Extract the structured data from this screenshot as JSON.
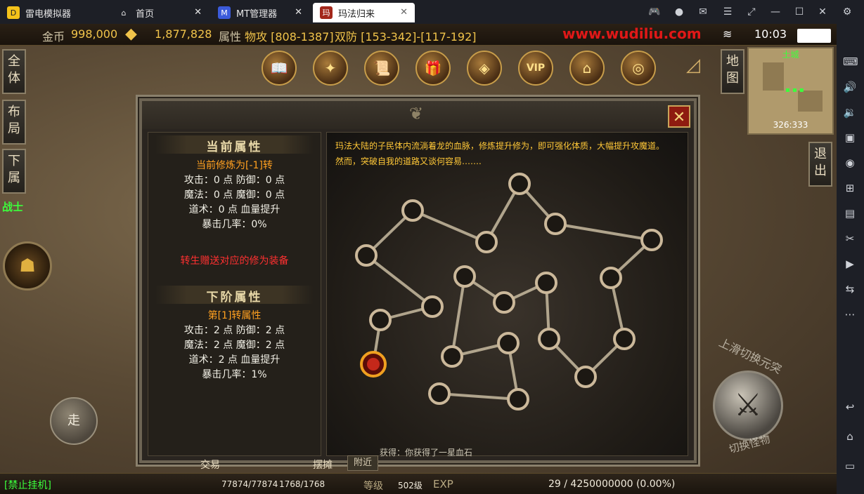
{
  "tabs": [
    {
      "label": "雷电模拟器",
      "icon": "leidian-logo-icon"
    },
    {
      "label": "首页",
      "icon": "home-icon"
    },
    {
      "label": "MT管理器",
      "icon": "mt-manager-icon"
    },
    {
      "label": "玛法归来",
      "icon": "game-icon"
    }
  ],
  "stats": {
    "gold_label": "金币",
    "gold_value": "998,000",
    "ingot_value": "1,877,828",
    "attr_label": "属性",
    "phys_atk": "物攻 [808-1387]",
    "dual_def": "双防 [153-342]-[117-192]",
    "website": "www.wudiliu.com",
    "time": "10:03"
  },
  "side_buttons": [
    "全体",
    "布局",
    "下属"
  ],
  "class_label": "战士",
  "map_buttons": [
    "地图",
    "退出"
  ],
  "minimap": {
    "area": "土城",
    "coords": "326:333"
  },
  "panel": {
    "current_title": "当前属性",
    "current_level": "当前修炼为[-1]转",
    "current_lines": [
      "攻击：0 点  防御：0 点",
      "魔法：0 点  魔御：0 点",
      "道术：0 点  血量提升",
      "暴击几率：0%"
    ],
    "gift_text": "转生赠送对应的修为装备",
    "next_title": "下阶属性",
    "next_level": "第[1]转属性",
    "next_lines": [
      "攻击：2 点  防御：2 点",
      "魔法：2 点  魔御：2 点",
      "道术：2 点  血量提升",
      "暴击几率：1%"
    ],
    "description_1": "玛法大陆的子民体内流淌着龙的血脉，修炼提升修为，即可强化体质，大幅提升攻魔道。",
    "description_2": "然而，突破自我的道路又谈何容易……."
  },
  "walk_label": "走",
  "swipe_hint": "上滑切换元突",
  "switch_monster": "切换怪物",
  "bottom": {
    "ban_label": "[禁止挂机]",
    "hp": "77874/77874",
    "mp": "1768/1768",
    "trade": "交易",
    "stall": "摆摊",
    "nearby": "附近",
    "chat": "获得：你获得了一星血石",
    "level_label": "等级",
    "level_value": "502级",
    "exp_label": "EXP",
    "exp_value": "29 / 4250000000 (0.00%)"
  },
  "colors": {
    "accent_gold": "#f0c34a",
    "desc_text": "#ffc838",
    "red_text": "#ff3030",
    "orange_text": "#ffa020"
  }
}
